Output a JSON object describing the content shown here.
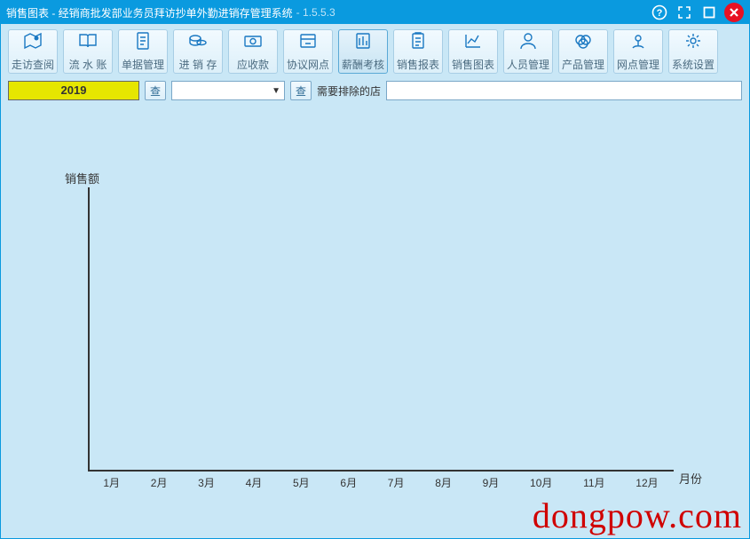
{
  "window": {
    "title_main": "销售图表 - 经销商批发部业务员拜访抄单外勤进销存管理系统",
    "title_sep": " - ",
    "version": "1.5.5.3"
  },
  "winbuttons": {
    "help": "?",
    "fullscreen": "fullscreen",
    "restore": "restore",
    "close": "close"
  },
  "toolbar": [
    {
      "key": "visit",
      "label": "走访查阅"
    },
    {
      "key": "ledger",
      "label": "流 水 账"
    },
    {
      "key": "orders",
      "label": "单据管理"
    },
    {
      "key": "stock",
      "label": "进 销 存"
    },
    {
      "key": "receiv",
      "label": "应收款"
    },
    {
      "key": "branch",
      "label": "协议网点"
    },
    {
      "key": "salary",
      "label": "薪酬考核",
      "active": true
    },
    {
      "key": "report",
      "label": "销售报表"
    },
    {
      "key": "chart",
      "label": "销售图表"
    },
    {
      "key": "staff",
      "label": "人员管理"
    },
    {
      "key": "product",
      "label": "产品管理"
    },
    {
      "key": "network",
      "label": "网点管理"
    },
    {
      "key": "settings",
      "label": "系统设置"
    }
  ],
  "filter": {
    "year": "2019",
    "lookup_btn": "查",
    "combo_value": "",
    "lookup_btn2": "查",
    "exclude_label": "需要排除的店",
    "exclude_value": ""
  },
  "chart_data": {
    "type": "bar",
    "title": "",
    "ylabel": "销售额",
    "xlabel": "月份",
    "categories": [
      "1月",
      "2月",
      "3月",
      "4月",
      "5月",
      "6月",
      "7月",
      "8月",
      "9月",
      "10月",
      "11月",
      "12月"
    ],
    "values": [
      0,
      0,
      0,
      0,
      0,
      0,
      0,
      0,
      0,
      0,
      0,
      0
    ],
    "ylim": [
      0,
      100
    ]
  },
  "watermark": "dongpow.com"
}
